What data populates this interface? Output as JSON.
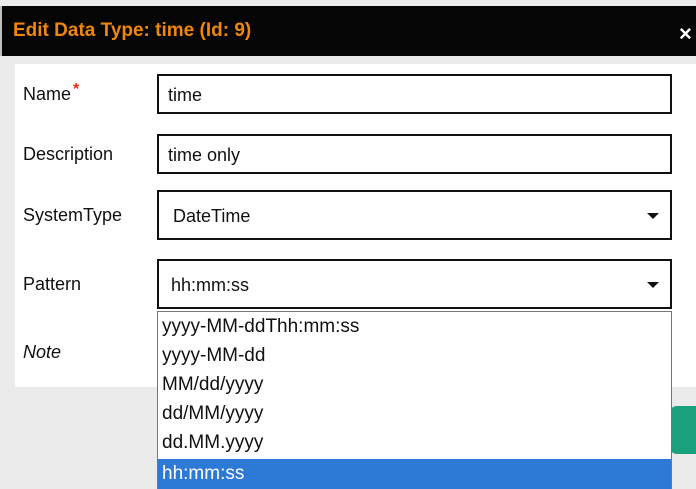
{
  "dialog": {
    "title": "Edit Data Type: time (Id: 9)",
    "close_symbol": "×"
  },
  "form": {
    "name_label": "Name",
    "required_mark": "*",
    "name_value": "time",
    "description_label": "Description",
    "description_value": "time only",
    "system_type_label": "SystemType",
    "system_type_value": "DateTime",
    "pattern_label": "Pattern",
    "pattern_value": "hh:mm:ss",
    "note_label": "Note"
  },
  "pattern_options": [
    "yyyy-MM-ddThh:mm:ss",
    "yyyy-MM-dd",
    "MM/dd/yyyy",
    "dd/MM/yyyy",
    "dd.MM.yyyy",
    "hh:mm:ss"
  ],
  "colors": {
    "title_accent": "#f0860a",
    "required": "#e03010",
    "selected_option": "#2d79d6",
    "action_button": "#1aa17d"
  }
}
